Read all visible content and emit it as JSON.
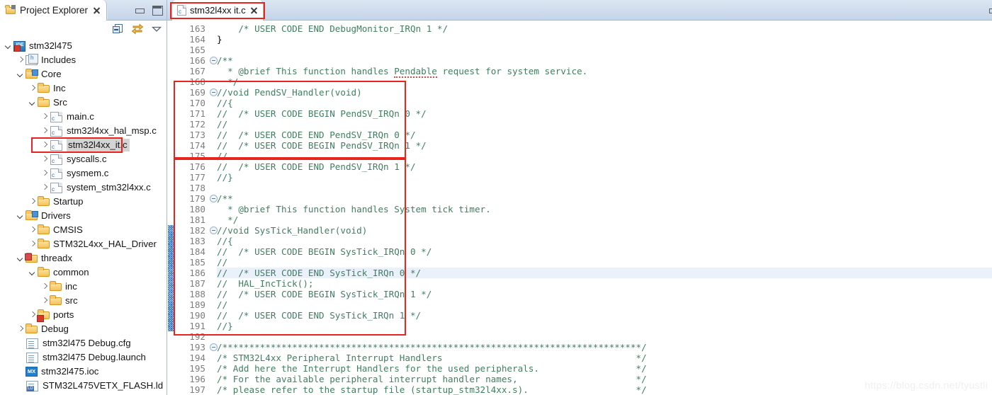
{
  "explorer": {
    "view_title": "Project Explorer",
    "view_icon": "project-explorer-icon",
    "close_icon": "close-icon",
    "minimize_label": "Minimize",
    "maximize_label": "Maximize",
    "toolbar": [
      {
        "name": "collapse-all-icon",
        "label": "Collapse All"
      },
      {
        "name": "link-with-editor-icon",
        "label": "Link with Editor"
      },
      {
        "name": "view-menu-icon",
        "label": "View Menu"
      }
    ],
    "tree": [
      {
        "label": "stm32l475",
        "indent": 0,
        "arrow": "down",
        "icon": "ide-project-icon",
        "selected": false
      },
      {
        "label": "Includes",
        "indent": 1,
        "arrow": "right",
        "icon": "includes-icon",
        "selected": false
      },
      {
        "label": "Core",
        "indent": 1,
        "arrow": "down",
        "icon": "source-folder-icon",
        "selected": false
      },
      {
        "label": "Inc",
        "indent": 2,
        "arrow": "right",
        "icon": "folder-icon",
        "selected": false
      },
      {
        "label": "Src",
        "indent": 2,
        "arrow": "down",
        "icon": "folder-icon",
        "selected": false
      },
      {
        "label": "main.c",
        "indent": 3,
        "arrow": "right",
        "icon": "c-file-icon",
        "selected": false
      },
      {
        "label": "stm32l4xx_hal_msp.c",
        "indent": 3,
        "arrow": "right",
        "icon": "c-file-icon",
        "selected": false
      },
      {
        "label": "stm32l4xx_it.c",
        "indent": 3,
        "arrow": "right",
        "icon": "c-file-icon",
        "selected": true
      },
      {
        "label": "syscalls.c",
        "indent": 3,
        "arrow": "right",
        "icon": "c-file-icon",
        "selected": false
      },
      {
        "label": "sysmem.c",
        "indent": 3,
        "arrow": "right",
        "icon": "c-file-icon",
        "selected": false
      },
      {
        "label": "system_stm32l4xx.c",
        "indent": 3,
        "arrow": "right",
        "icon": "c-file-icon",
        "selected": false
      },
      {
        "label": "Startup",
        "indent": 2,
        "arrow": "right",
        "icon": "folder-icon",
        "selected": false
      },
      {
        "label": "Drivers",
        "indent": 1,
        "arrow": "down",
        "icon": "source-folder-icon",
        "selected": false
      },
      {
        "label": "CMSIS",
        "indent": 2,
        "arrow": "right",
        "icon": "folder-icon",
        "selected": false
      },
      {
        "label": "STM32L4xx_HAL_Driver",
        "indent": 2,
        "arrow": "right",
        "icon": "folder-icon",
        "selected": false
      },
      {
        "label": "threadx",
        "indent": 1,
        "arrow": "down",
        "icon": "source-folder-error-icon",
        "selected": false
      },
      {
        "label": "common",
        "indent": 2,
        "arrow": "down",
        "icon": "folder-icon",
        "selected": false
      },
      {
        "label": "inc",
        "indent": 3,
        "arrow": "right",
        "icon": "folder-icon",
        "selected": false
      },
      {
        "label": "src",
        "indent": 3,
        "arrow": "right",
        "icon": "folder-icon",
        "selected": false
      },
      {
        "label": "ports",
        "indent": 2,
        "arrow": "right",
        "icon": "folder-error-icon",
        "selected": false
      },
      {
        "label": "Debug",
        "indent": 1,
        "arrow": "right",
        "icon": "folder-icon",
        "selected": false
      },
      {
        "label": "stm32l475 Debug.cfg",
        "indent": 1,
        "arrow": "none",
        "icon": "document-icon",
        "selected": false
      },
      {
        "label": "stm32l475 Debug.launch",
        "indent": 1,
        "arrow": "none",
        "icon": "document-icon",
        "selected": false
      },
      {
        "label": "stm32l475.ioc",
        "indent": 1,
        "arrow": "none",
        "icon": "cubemx-icon",
        "selected": false
      },
      {
        "label": "STM32L475VETX_FLASH.ld",
        "indent": 1,
        "arrow": "none",
        "icon": "linker-script-icon",
        "selected": false
      }
    ]
  },
  "editor": {
    "tab": {
      "label": "stm32l4xx it.c",
      "file_icon": "c-file-icon",
      "close_icon": "close-icon"
    },
    "minimize_label": "Minimize",
    "current_line": 186,
    "lines": [
      {
        "n": 163,
        "fold": false,
        "change": false,
        "segments": [
          {
            "t": "    /* USER CODE END DebugMonitor_IRQn 1 */",
            "c": "cmt"
          }
        ]
      },
      {
        "n": 164,
        "fold": false,
        "change": false,
        "segments": [
          {
            "t": "}",
            "c": "plain"
          }
        ]
      },
      {
        "n": 165,
        "fold": false,
        "change": false,
        "segments": [
          {
            "t": "",
            "c": "plain"
          }
        ]
      },
      {
        "n": 166,
        "fold": true,
        "change": false,
        "segments": [
          {
            "t": "/**",
            "c": "cmt"
          }
        ]
      },
      {
        "n": 167,
        "fold": false,
        "change": false,
        "segments": [
          {
            "t": "  * @brief This function handles ",
            "c": "cmt"
          },
          {
            "t": "Pendable",
            "c": "cmt spell"
          },
          {
            "t": " request for system service.",
            "c": "cmt"
          }
        ]
      },
      {
        "n": 168,
        "fold": false,
        "change": false,
        "segments": [
          {
            "t": "  */",
            "c": "cmt"
          }
        ]
      },
      {
        "n": 169,
        "fold": true,
        "change": false,
        "segments": [
          {
            "t": "//void PendSV_Handler(void)",
            "c": "cmt"
          }
        ]
      },
      {
        "n": 170,
        "fold": false,
        "change": false,
        "segments": [
          {
            "t": "//{",
            "c": "cmt"
          }
        ]
      },
      {
        "n": 171,
        "fold": false,
        "change": false,
        "segments": [
          {
            "t": "//  /* USER CODE BEGIN PendSV_IRQn 0 */",
            "c": "cmt"
          }
        ]
      },
      {
        "n": 172,
        "fold": false,
        "change": false,
        "segments": [
          {
            "t": "//",
            "c": "cmt"
          }
        ]
      },
      {
        "n": 173,
        "fold": false,
        "change": false,
        "segments": [
          {
            "t": "//  /* USER CODE END PendSV_IRQn 0 */",
            "c": "cmt"
          }
        ]
      },
      {
        "n": 174,
        "fold": false,
        "change": false,
        "segments": [
          {
            "t": "//  /* USER CODE BEGIN PendSV_IRQn 1 */",
            "c": "cmt"
          }
        ]
      },
      {
        "n": 175,
        "fold": false,
        "change": false,
        "segments": [
          {
            "t": "//",
            "c": "cmt"
          }
        ]
      },
      {
        "n": 176,
        "fold": false,
        "change": false,
        "segments": [
          {
            "t": "//  /* USER CODE END PendSV_IRQn 1 */",
            "c": "cmt"
          }
        ]
      },
      {
        "n": 177,
        "fold": false,
        "change": false,
        "segments": [
          {
            "t": "//}",
            "c": "cmt"
          }
        ]
      },
      {
        "n": 178,
        "fold": false,
        "change": false,
        "segments": [
          {
            "t": "",
            "c": "plain"
          }
        ]
      },
      {
        "n": 179,
        "fold": true,
        "change": false,
        "segments": [
          {
            "t": "/**",
            "c": "cmt"
          }
        ]
      },
      {
        "n": 180,
        "fold": false,
        "change": false,
        "segments": [
          {
            "t": "  * @brief This function handles System tick timer.",
            "c": "cmt"
          }
        ]
      },
      {
        "n": 181,
        "fold": false,
        "change": false,
        "segments": [
          {
            "t": "  */",
            "c": "cmt"
          }
        ]
      },
      {
        "n": 182,
        "fold": true,
        "change": true,
        "segments": [
          {
            "t": "//void SysTick_Handler(void)",
            "c": "cmt"
          }
        ]
      },
      {
        "n": 183,
        "fold": false,
        "change": true,
        "segments": [
          {
            "t": "//{",
            "c": "cmt"
          }
        ]
      },
      {
        "n": 184,
        "fold": false,
        "change": true,
        "segments": [
          {
            "t": "//  /* USER CODE BEGIN SysTick_IRQn 0 */",
            "c": "cmt"
          }
        ]
      },
      {
        "n": 185,
        "fold": false,
        "change": true,
        "segments": [
          {
            "t": "//",
            "c": "cmt"
          }
        ]
      },
      {
        "n": 186,
        "fold": false,
        "change": true,
        "segments": [
          {
            "t": "//  /* USER CODE END SysTick_IRQn 0 */",
            "c": "cmt"
          }
        ]
      },
      {
        "n": 187,
        "fold": false,
        "change": true,
        "segments": [
          {
            "t": "//  HAL_IncTick();",
            "c": "cmt"
          }
        ]
      },
      {
        "n": 188,
        "fold": false,
        "change": true,
        "segments": [
          {
            "t": "//  /* USER CODE BEGIN SysTick_IRQn 1 */",
            "c": "cmt"
          }
        ]
      },
      {
        "n": 189,
        "fold": false,
        "change": true,
        "segments": [
          {
            "t": "//",
            "c": "cmt"
          }
        ]
      },
      {
        "n": 190,
        "fold": false,
        "change": true,
        "segments": [
          {
            "t": "//  /* USER CODE END SysTick_IRQn 1 */",
            "c": "cmt"
          }
        ]
      },
      {
        "n": 191,
        "fold": false,
        "change": true,
        "segments": [
          {
            "t": "//}",
            "c": "cmt"
          }
        ]
      },
      {
        "n": 192,
        "fold": false,
        "change": false,
        "segments": [
          {
            "t": "",
            "c": "plain"
          }
        ]
      },
      {
        "n": 193,
        "fold": true,
        "change": false,
        "segments": [
          {
            "t": "/******************************************************************************/",
            "c": "cmt"
          }
        ]
      },
      {
        "n": 194,
        "fold": false,
        "change": false,
        "segments": [
          {
            "t": "/* STM32L4xx Peripheral Interrupt Handlers                                    */",
            "c": "cmt"
          }
        ]
      },
      {
        "n": 195,
        "fold": false,
        "change": false,
        "segments": [
          {
            "t": "/* Add here the Interrupt Handlers for the used peripherals.                  */",
            "c": "cmt"
          }
        ]
      },
      {
        "n": 196,
        "fold": false,
        "change": false,
        "segments": [
          {
            "t": "/* For the available peripheral interrupt handler names,                      */",
            "c": "cmt"
          }
        ]
      },
      {
        "n": 197,
        "fold": false,
        "change": false,
        "segments": [
          {
            "t": "/* please refer to the startup file (startup_stm32l4xx.s).                    */",
            "c": "cmt"
          }
        ]
      }
    ]
  },
  "annotations": {
    "highlight_color": "#e8251c",
    "boxes": [
      {
        "name": "selected-file-highlight-box"
      },
      {
        "name": "editor-tab-highlight-box"
      },
      {
        "name": "commented-pendsv-block-box"
      },
      {
        "name": "commented-systick-block-box"
      }
    ]
  },
  "watermark": {
    "text": "https://blog.csdn.net/tyustli"
  }
}
